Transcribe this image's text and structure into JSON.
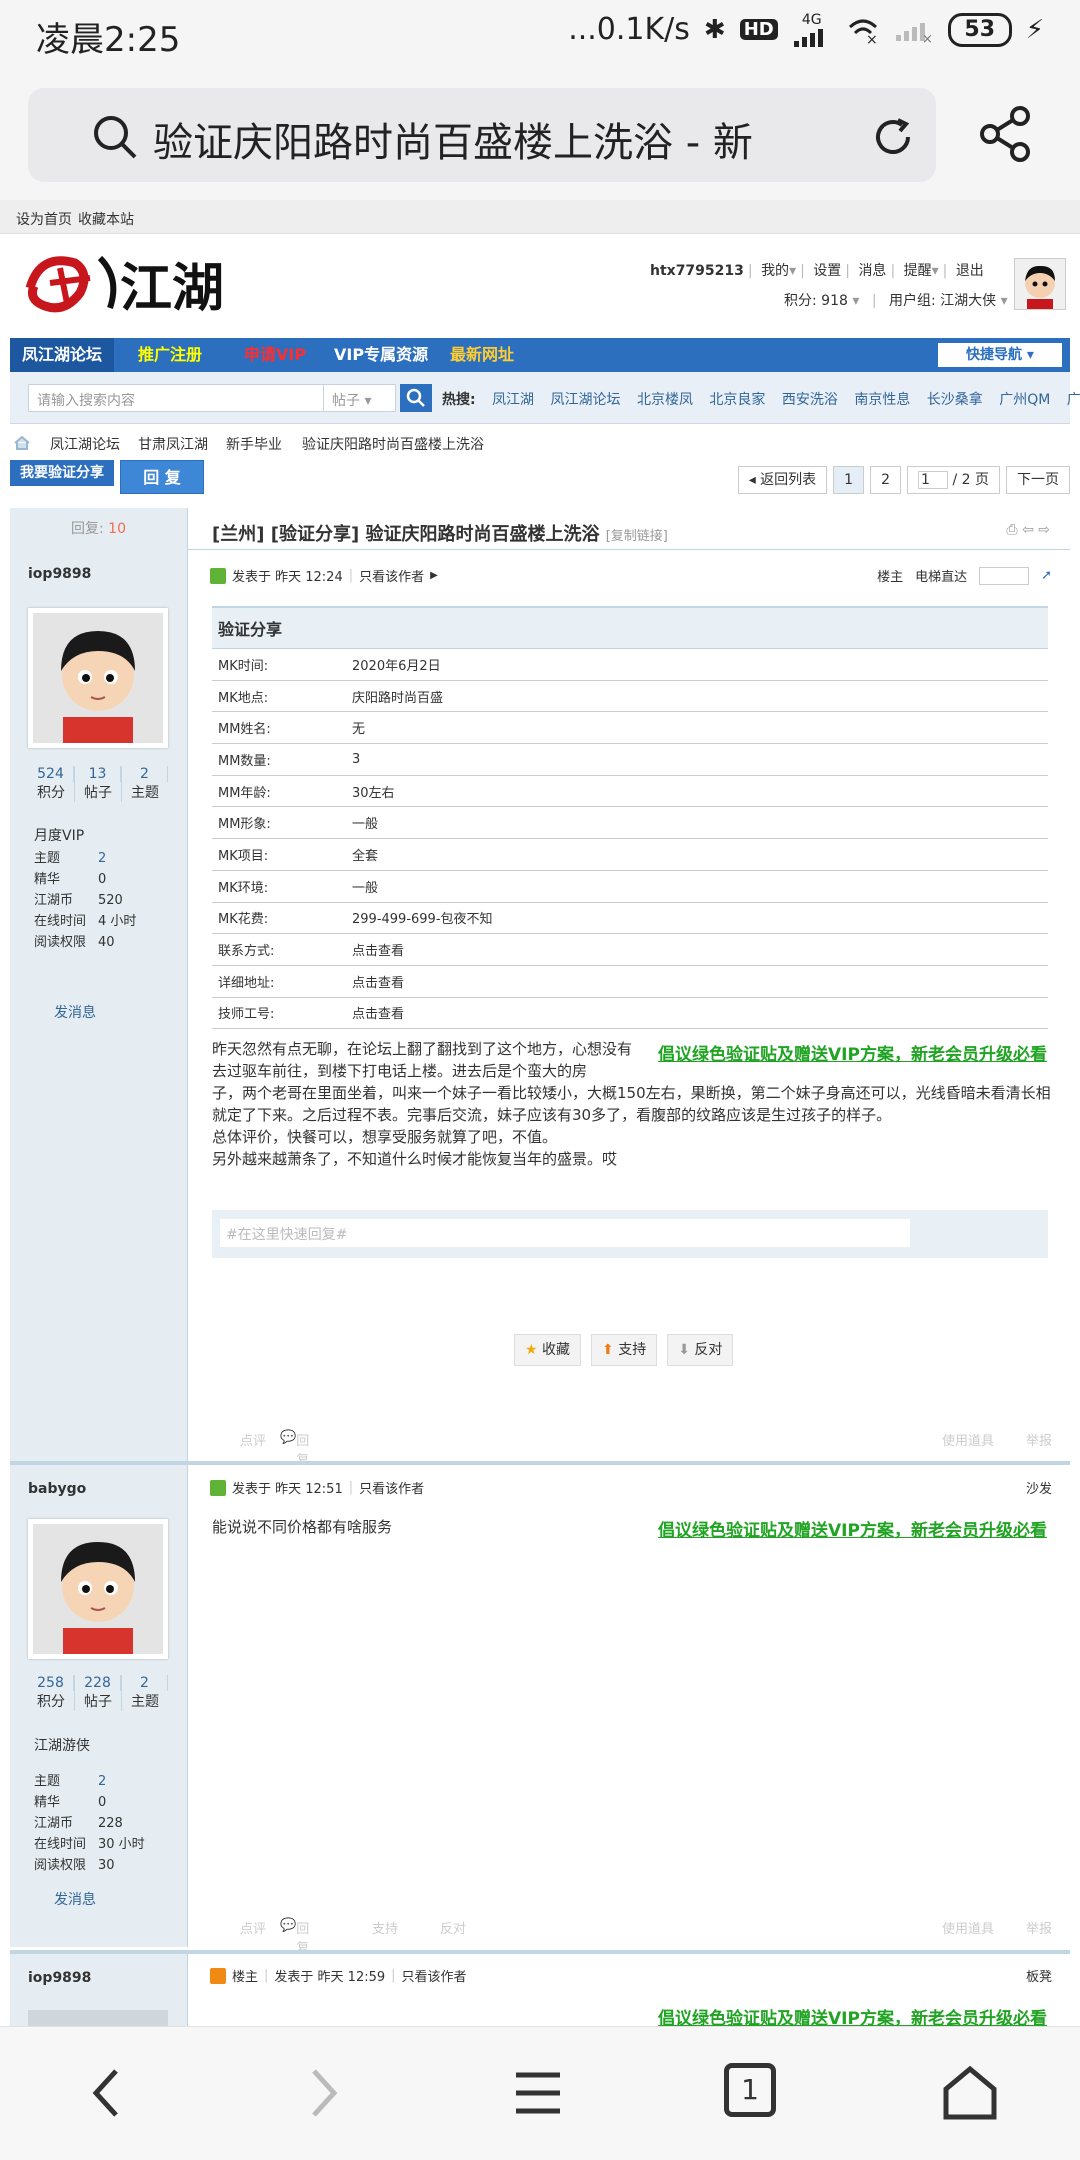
{
  "status_bar": {
    "time": "凌晨2:25",
    "net_speed": "...0.1K/s",
    "hd": "HD",
    "net_type": "4G",
    "battery": "53"
  },
  "browser": {
    "url_title": "验证庆阳路时尚百盛楼上洗浴 - 新"
  },
  "site": {
    "top_links": [
      "设为首页",
      "收藏本站"
    ],
    "logo_text": "江湖",
    "user": {
      "name": "htx7795213",
      "menu": [
        "我的",
        "设置",
        "消息",
        "提醒",
        "退出"
      ],
      "points_label": "积分: 918",
      "group_label": "用户组: 江湖大侠"
    },
    "nav": [
      {
        "label": "凤江湖论坛",
        "color": "#ffffff"
      },
      {
        "label": "推广注册",
        "color": "#ffff00"
      },
      {
        "label": "申请VIP",
        "color": "#ff2d2d"
      },
      {
        "label": "VIP专属资源",
        "color": "#ffffff"
      },
      {
        "label": "最新网址",
        "color": "#ffcc33"
      }
    ],
    "quick_nav": "快捷导航",
    "search": {
      "placeholder": "请输入搜索内容",
      "type": "帖子",
      "hot_label": "热搜:",
      "hot": [
        "凤江湖",
        "凤江湖论坛",
        "北京楼凤",
        "北京良家",
        "西安洗浴",
        "南京性息",
        "长沙桑拿",
        "广州QM",
        "广州桑拿"
      ]
    },
    "breadcrumb": [
      "凤江湖论坛",
      "甘肃凤江湖",
      "新手毕业",
      "验证庆阳路时尚百盛楼上洗浴"
    ]
  },
  "actions": {
    "post_button": "我要验证分享",
    "reply_button": "回 复",
    "back_list": "返回列表",
    "page_1": "1",
    "page_2": "2",
    "page_input": "1",
    "page_total": "/ 2 页",
    "next_page": "下一页"
  },
  "thread": {
    "reply_label": "回复:",
    "reply_count": "10",
    "title": "[兰州] [验证分享] 验证庆阳路时尚百盛楼上洗浴",
    "copy_link": "[复制链接]"
  },
  "posts": [
    {
      "author": "iop9898",
      "points": "524",
      "posts": "13",
      "topics": "2",
      "level": "月度VIP",
      "info": [
        {
          "k": "主题",
          "v": "2"
        },
        {
          "k": "精华",
          "v": "0"
        },
        {
          "k": "江湖币",
          "v": "520"
        },
        {
          "k": "在线时间",
          "v": "4 小时"
        },
        {
          "k": "阅读权限",
          "v": "40"
        }
      ],
      "send_msg": "发消息",
      "time": "发表于 昨天 12:24",
      "only_author": "只看该作者",
      "floor": "楼主",
      "elevator": "电梯直达",
      "table_title": "验证分享",
      "table": [
        {
          "k": "MK时间:",
          "v": "2020年6月2日"
        },
        {
          "k": "MK地点:",
          "v": "庆阳路时尚百盛"
        },
        {
          "k": "MM姓名:",
          "v": "无"
        },
        {
          "k": "MM数量:",
          "v": "3"
        },
        {
          "k": "MM年龄:",
          "v": "30左右"
        },
        {
          "k": "MM形象:",
          "v": "一般"
        },
        {
          "k": "MK项目:",
          "v": "全套"
        },
        {
          "k": "MK环境:",
          "v": "一般"
        },
        {
          "k": "MK花费:",
          "v": "299-499-699-包夜不知"
        },
        {
          "k": "联系方式:",
          "v": "点击查看"
        },
        {
          "k": "详细地址:",
          "v": "点击查看"
        },
        {
          "k": "技师工号:",
          "v": "点击查看"
        }
      ],
      "text_a": "昨天忽然有点无聊，在论坛上翻了翻找到了这个地方，心想没有去过驱车前往，到楼下打电话上楼。进去后是个蛮大的房",
      "text_b": "子，两个老哥在里面坐着，叫来一个妹子一看比较矮小，大概150左右，果断换，第二个妹子身高还可以，光线昏暗未看清长相就定了下来。之后过程不表。完事后交流，妹子应该有30多了，看腹部的纹路应该是生过孩子的样子。",
      "text_c": "总体评价，快餐可以，想享受服务就算了吧，不值。",
      "text_d": "另外越来越萧条了，不知道什么时候才能恢复当年的盛景。哎",
      "promo": "倡议绿色验证贴及赠送VIP方案，新老会员升级必看",
      "quick_reply_placeholder": "#在这里快速回复#",
      "votes": [
        "收藏",
        "支持",
        "反对"
      ],
      "foot": [
        "点评",
        "回复",
        "使用道具",
        "举报"
      ]
    },
    {
      "author": "babygo",
      "points": "258",
      "posts": "228",
      "topics": "2",
      "level": "江湖游侠",
      "info": [
        {
          "k": "主题",
          "v": "2"
        },
        {
          "k": "精华",
          "v": "0"
        },
        {
          "k": "江湖币",
          "v": "228"
        },
        {
          "k": "在线时间",
          "v": "30 小时"
        },
        {
          "k": "阅读权限",
          "v": "30"
        }
      ],
      "send_msg": "发消息",
      "time": "发表于 昨天 12:51",
      "only_author": "只看该作者",
      "floor": "沙发",
      "text": "能说说不同价格都有啥服务",
      "promo": "倡议绿色验证贴及赠送VIP方案，新老会员升级必看",
      "foot": [
        "点评",
        "回复",
        "支持",
        "反对",
        "使用道具",
        "举报"
      ]
    },
    {
      "author": "iop9898",
      "badge": "楼主",
      "time": "发表于 昨天 12:59",
      "only_author": "只看该作者",
      "floor": "板凳",
      "promo": "倡议绿色验证贴及赠送VIP方案，新老会员升级必看"
    }
  ],
  "labels": {
    "points": "积分",
    "posts": "帖子",
    "topics": "主题"
  },
  "bottom_nav": {
    "tab_count": "1"
  }
}
